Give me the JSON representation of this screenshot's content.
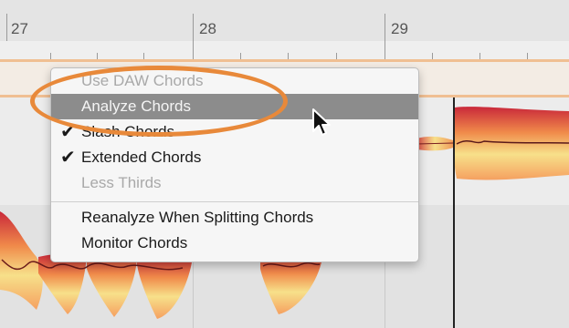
{
  "ruler": {
    "bars": [
      {
        "label": "27"
      },
      {
        "label": "28"
      },
      {
        "label": "29"
      }
    ]
  },
  "context_menu": {
    "items": [
      {
        "label": "Use DAW Chords",
        "enabled": false,
        "checked": false,
        "highlighted": false
      },
      {
        "label": "Analyze Chords",
        "enabled": true,
        "checked": false,
        "highlighted": true
      },
      {
        "label": "Slash Chords",
        "enabled": true,
        "checked": true,
        "highlighted": false
      },
      {
        "label": "Extended Chords",
        "enabled": true,
        "checked": true,
        "highlighted": false
      },
      {
        "label": "Less Thirds",
        "enabled": false,
        "checked": false,
        "highlighted": false
      },
      {
        "label": "Reanalyze When Splitting Chords",
        "enabled": true,
        "checked": false,
        "highlighted": false
      },
      {
        "label": "Monitor Chords",
        "enabled": true,
        "checked": false,
        "highlighted": false
      }
    ],
    "check_glyph": "✔"
  },
  "annotation": {
    "highlight_color": "#e8893a"
  },
  "colors": {
    "blob_outer": "#c9283a",
    "blob_inner": "#f7e08a",
    "chord_lane_border": "#f0bf92"
  }
}
